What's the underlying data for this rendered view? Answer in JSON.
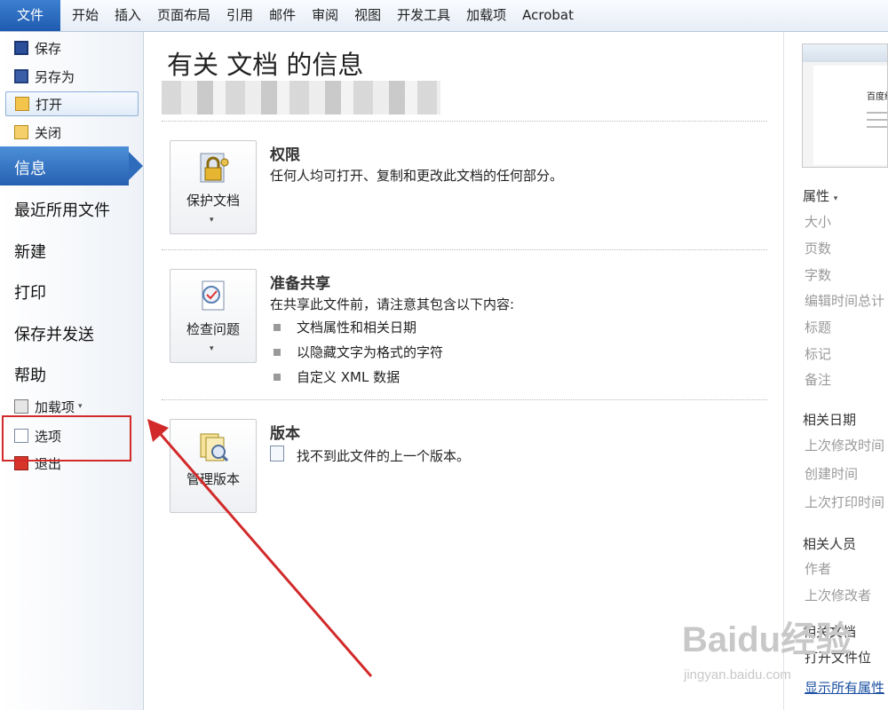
{
  "ribbon": {
    "file_tab": "文件",
    "tabs": [
      "开始",
      "插入",
      "页面布局",
      "引用",
      "邮件",
      "审阅",
      "视图",
      "开发工具",
      "加载项",
      "Acrobat"
    ]
  },
  "nav": {
    "commands": {
      "save": "保存",
      "save_as": "另存为",
      "open": "打开",
      "close": "关闭",
      "addins": "加载项",
      "options": "选项",
      "exit": "退出"
    },
    "tabs": {
      "info": "信息",
      "recent": "最近所用文件",
      "new": "新建",
      "print": "打印",
      "save_send": "保存并发送",
      "help": "帮助"
    }
  },
  "main": {
    "title": "有关 文档 的信息",
    "permissions": {
      "button": "保护文档",
      "heading": "权限",
      "text": "任何人均可打开、复制和更改此文档的任何部分。"
    },
    "prepare": {
      "button": "检查问题",
      "heading": "准备共享",
      "text": "在共享此文件前，请注意其包含以下内容:",
      "items": [
        "文档属性和相关日期",
        "以隐藏文字为格式的字符",
        "自定义 XML 数据"
      ]
    },
    "versions": {
      "button": "管理版本",
      "heading": "版本",
      "text": "找不到此文件的上一个版本。"
    }
  },
  "properties": {
    "preview_text": "百度经",
    "heading": "属性",
    "fields": [
      "大小",
      "页数",
      "字数",
      "编辑时间总计",
      "标题",
      "标记",
      "备注"
    ],
    "dates_heading": "相关日期",
    "dates": [
      "上次修改时间",
      "创建时间",
      "上次打印时间"
    ],
    "people_heading": "相关人员",
    "people": [
      "作者",
      "上次修改者"
    ],
    "docs_heading": "相关文档",
    "docs_link": "打开文件位",
    "show_all": "显示所有属性"
  },
  "watermark": {
    "logo": "Baidu经验",
    "url": "jingyan.baidu.com"
  },
  "colors": {
    "accent": "#2a67b8",
    "annotation": "#d22a2a"
  }
}
